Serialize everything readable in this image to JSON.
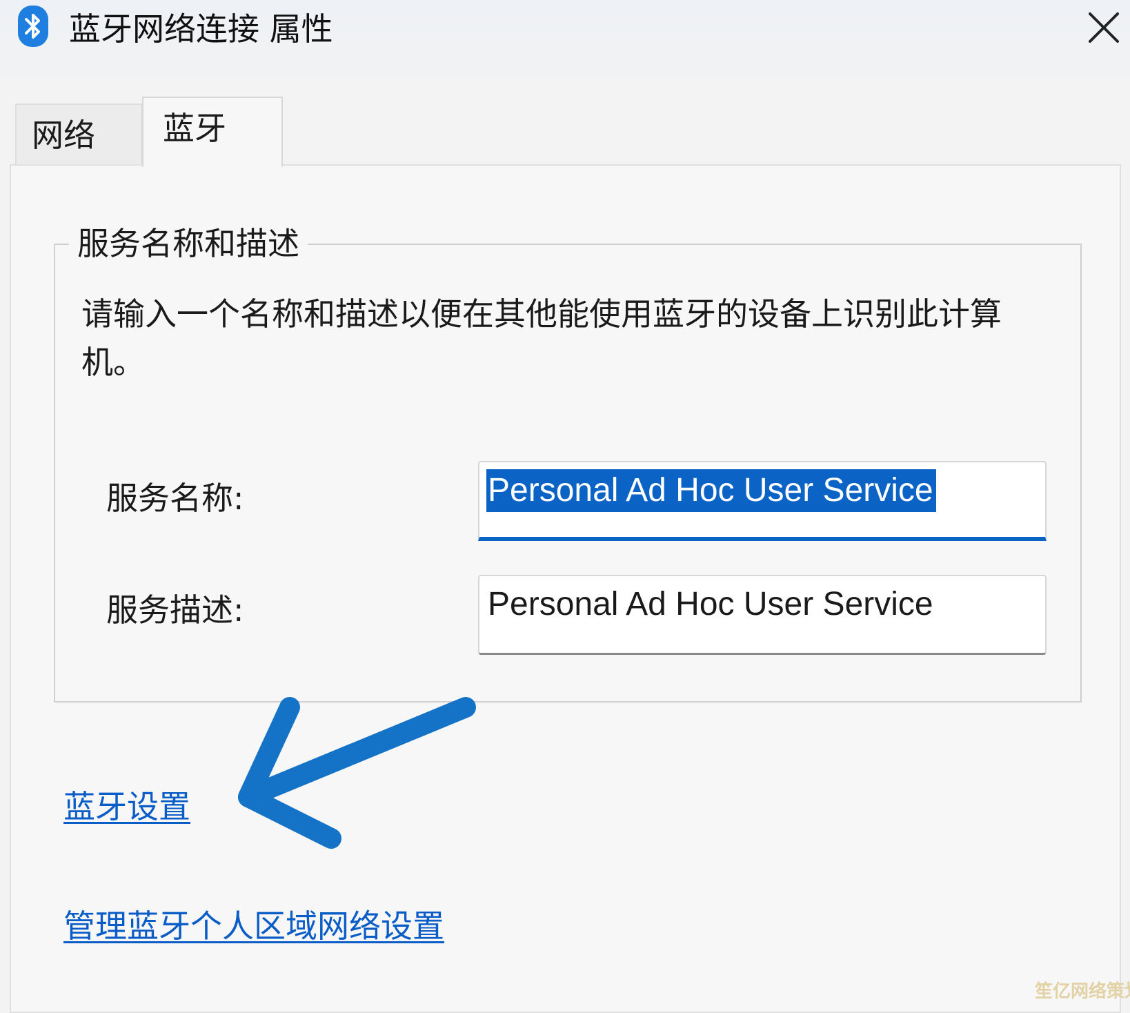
{
  "window": {
    "title": "蓝牙网络连接 属性",
    "title_icon": "bluetooth-icon",
    "close_icon": "close-icon"
  },
  "tabs": [
    {
      "label": "网络",
      "selected": false
    },
    {
      "label": "蓝牙",
      "selected": true
    }
  ],
  "group": {
    "legend": "服务名称和描述",
    "description": "请输入一个名称和描述以便在其他能使用蓝牙的设备上识别此计算机。"
  },
  "fields": {
    "service_name": {
      "label": "服务名称:",
      "value": "Personal Ad Hoc User Service"
    },
    "service_description": {
      "label": "服务描述:",
      "value": "Personal Ad Hoc User Service"
    }
  },
  "links": {
    "bluetooth_settings": "蓝牙设置",
    "manage_pan_settings": "管理蓝牙个人区域网络设置"
  },
  "watermark": "笙亿网络策划",
  "colors": {
    "accent": "#0b63c5",
    "link": "#0a5cc7",
    "annotation_arrow": "#1473c6",
    "background": "#f3f3f3"
  }
}
